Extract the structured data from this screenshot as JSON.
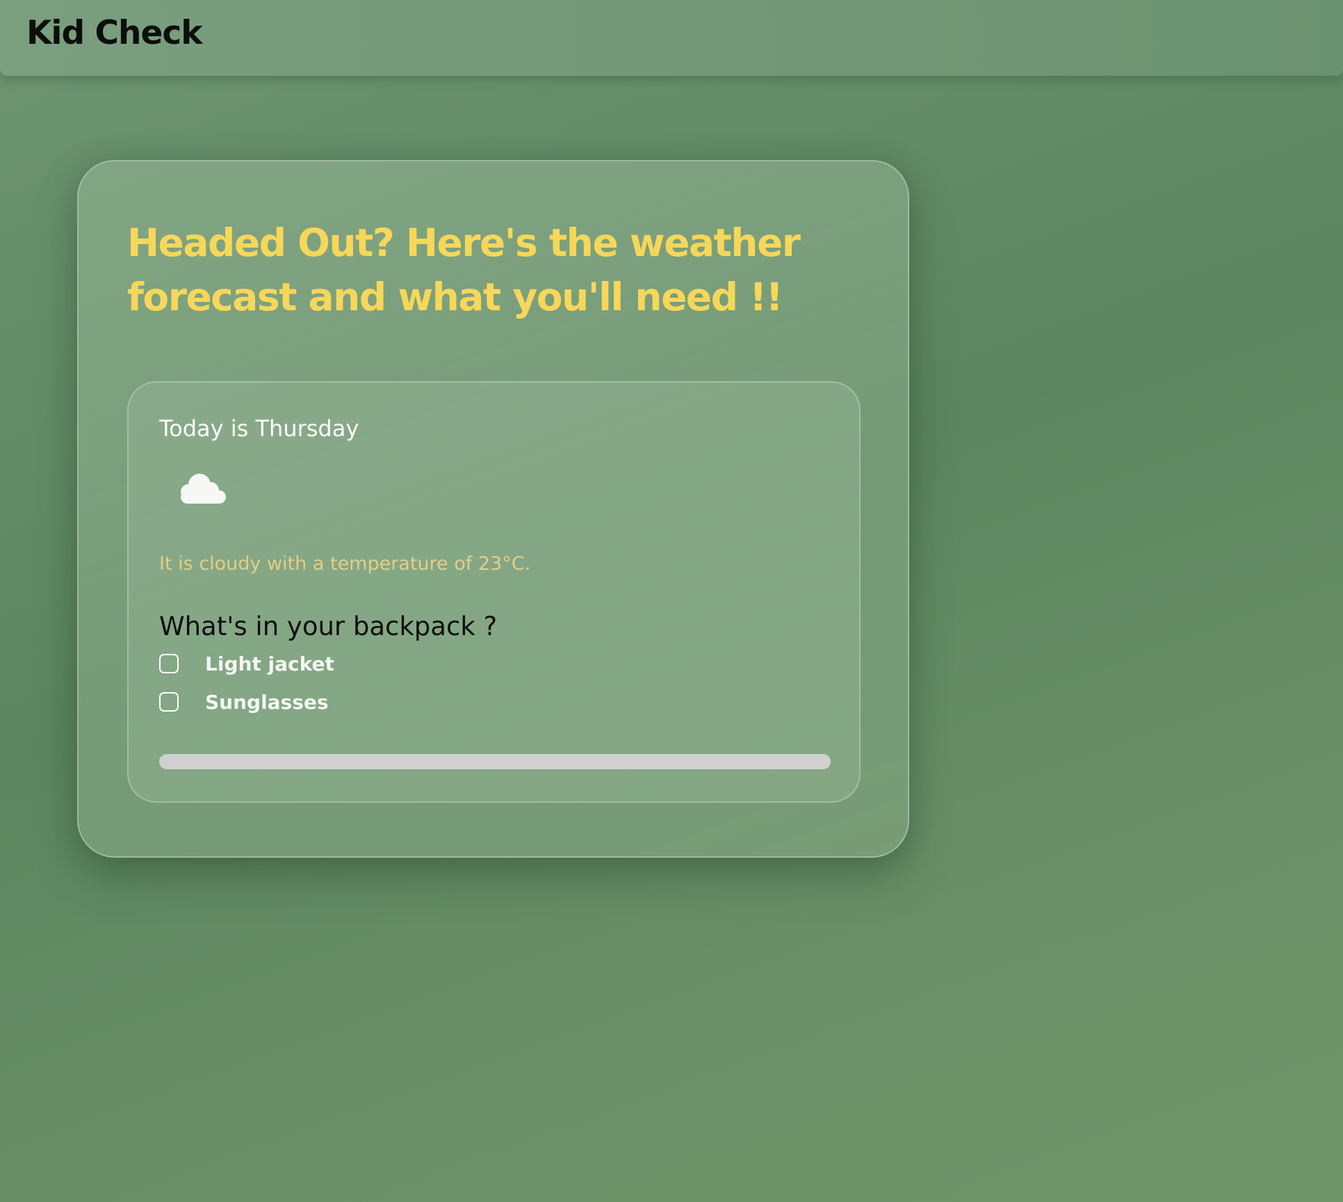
{
  "header": {
    "title": "Kid Check"
  },
  "card": {
    "heading": "Headed Out? Here's the weather forecast and what you'll need !!"
  },
  "forecast": {
    "day_text": "Today is Thursday",
    "weather_icon": "cloud-icon",
    "description": "It is cloudy with a temperature of 23°C."
  },
  "backpack": {
    "heading": "What's in your backpack ?",
    "items": [
      {
        "label": "Light jacket",
        "checked": false
      },
      {
        "label": "Sunglasses",
        "checked": false
      }
    ],
    "progress_fraction": 0
  },
  "colors": {
    "background": "#62896a",
    "heading_yellow": "#f6d75a",
    "description_gold": "#e3cf86",
    "progress_track": "#cfd0cf"
  }
}
